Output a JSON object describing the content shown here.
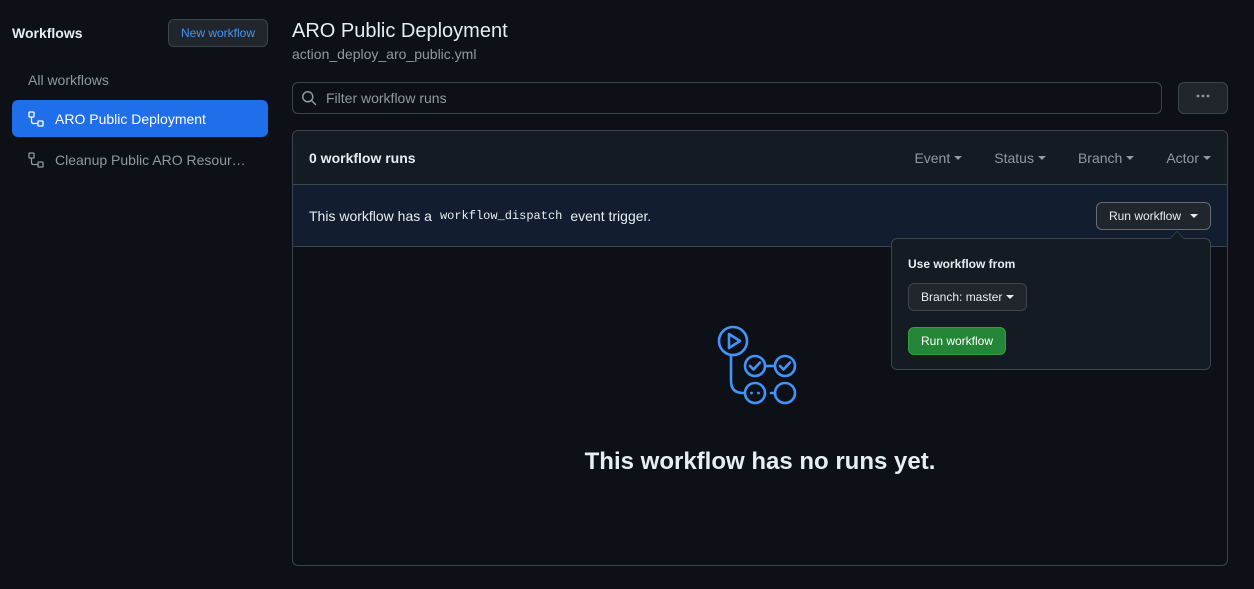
{
  "sidebar": {
    "title": "Workflows",
    "new_button": "New workflow",
    "all_workflows": "All workflows",
    "items": [
      {
        "label": "ARO Public Deployment",
        "icon": "workflow-icon",
        "active": true
      },
      {
        "label": "Cleanup Public ARO Resources",
        "icon": "workflow-icon",
        "active": false
      }
    ]
  },
  "header": {
    "title": "ARO Public Deployment",
    "file": "action_deploy_aro_public.yml"
  },
  "filter": {
    "placeholder": "Filter workflow runs",
    "icon": "search-icon",
    "more_icon": "kebab-horizontal-icon"
  },
  "runs": {
    "count_label": "0 workflow runs",
    "filters": [
      "Event",
      "Status",
      "Branch",
      "Actor"
    ]
  },
  "dispatch": {
    "text_before": "This workflow has a",
    "code": "workflow_dispatch",
    "text_after": "event trigger.",
    "run_button": "Run workflow"
  },
  "empty": {
    "icon": "workflow-runs-empty-icon",
    "message": "This workflow has no runs yet."
  },
  "popover": {
    "label": "Use workflow from",
    "branch_button": "Branch: master",
    "run_button": "Run workflow"
  },
  "colors": {
    "background": "#0d1117",
    "accent": "#1f6feb",
    "link": "#4493f8",
    "success": "#238636"
  }
}
